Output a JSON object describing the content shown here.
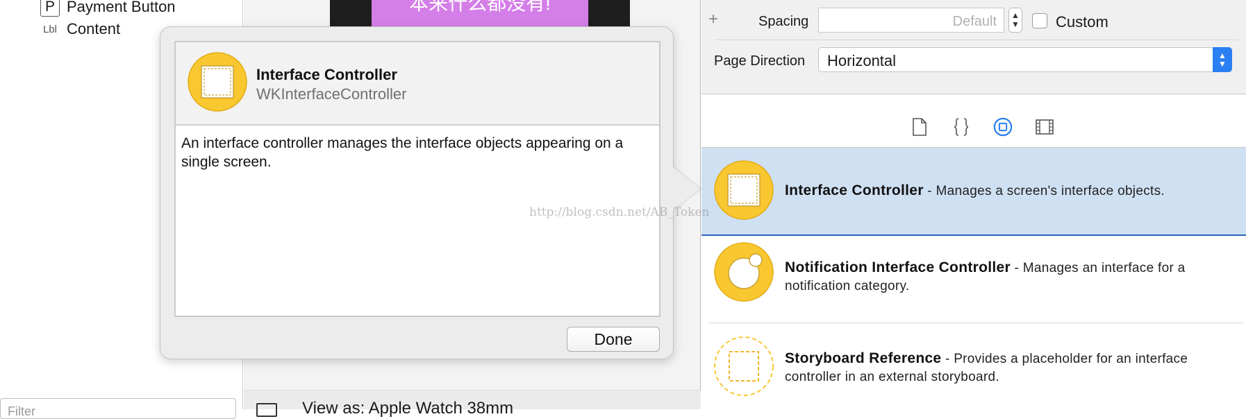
{
  "outline": {
    "items": [
      {
        "badge": "P",
        "label": "Payment Button"
      },
      {
        "badge": "Lbl",
        "label": "Content"
      }
    ],
    "filter_placeholder": "Filter"
  },
  "canvas": {
    "watch_label": "本来什么都没有!",
    "view_as_label": "View as: Apple Watch 38mm"
  },
  "popover": {
    "title": "Interface Controller",
    "class_name": "WKInterfaceController",
    "description": "An interface controller manages the interface objects appearing on a single screen.",
    "done_label": "Done"
  },
  "inspector": {
    "plus": "+",
    "spacing_label": "Spacing",
    "spacing_placeholder": "Default",
    "custom_label": "Custom",
    "page_direction_label": "Page Direction",
    "page_direction_value": "Horizontal"
  },
  "library": {
    "tabs": [
      "file-template-icon",
      "code-snippet-icon",
      "object-library-icon",
      "media-library-icon"
    ],
    "selected_tab": "object-library-icon",
    "items": [
      {
        "title": "Interface Controller",
        "description": " - Manages a screen's interface objects.",
        "icon": "interface-controller-icon"
      },
      {
        "title": "Notification Interface Controller",
        "description": " - Manages an interface for a notification category.",
        "icon": "notification-controller-icon"
      },
      {
        "title": "Storyboard Reference",
        "description": " - Provides a placeholder for an interface controller in an external storyboard.",
        "icon": "storyboard-reference-icon"
      }
    ]
  },
  "watermark": "http://blog.csdn.net/AB_Token",
  "colors": {
    "accent_blue": "#2a7ff2",
    "selection_bg": "#cfe0f2",
    "icon_yellow": "#f9c72f",
    "watch_label_bg": "#d47ee8"
  }
}
